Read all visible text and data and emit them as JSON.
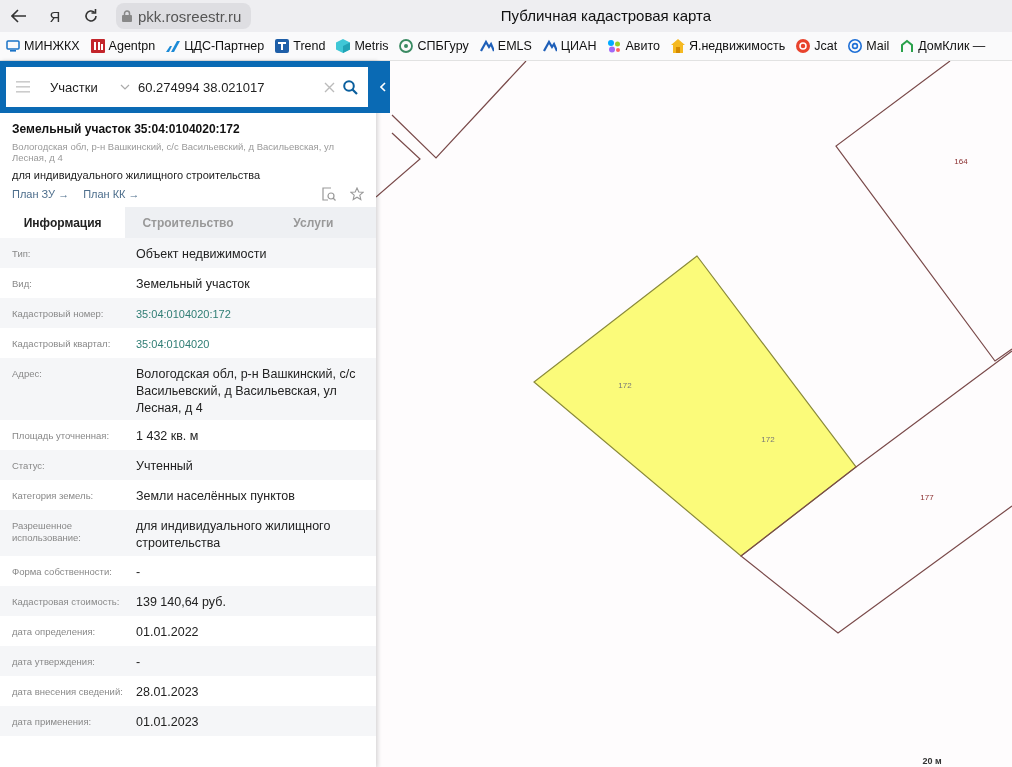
{
  "browser": {
    "home_glyph": "Я",
    "url": "pkk.rosreestr.ru",
    "page_title": "Публичная кадастровая карта"
  },
  "bookmarks": [
    {
      "label": "МИНЖКХ",
      "kind": "monitor"
    },
    {
      "label": "Agentpn",
      "kind": "agent"
    },
    {
      "label": "ЦДС-Партнер",
      "kind": "slash"
    },
    {
      "label": "Trend",
      "kind": "trend"
    },
    {
      "label": "Metris",
      "kind": "cube"
    },
    {
      "label": "СПБГуру",
      "kind": "pin"
    },
    {
      "label": "EMLS",
      "kind": "peak"
    },
    {
      "label": "ЦИАН",
      "kind": "peak"
    },
    {
      "label": "Авито",
      "kind": "dots"
    },
    {
      "label": "Я.недвижимость",
      "kind": "house"
    },
    {
      "label": "Jcat",
      "kind": "jcat"
    },
    {
      "label": "Mail",
      "kind": "at"
    },
    {
      "label": "ДомКлик —",
      "kind": "domklik"
    }
  ],
  "search": {
    "layer": "Участки",
    "query": "60.274994 38.021017"
  },
  "object": {
    "title": "Земельный участок 35:04:0104020:172",
    "address": "Вологодская обл, р-н Вашкинский, с/с Васильевский, д Васильевская, ул Лесная, д 4",
    "purpose": "для индивидуального жилищного строительства",
    "links": [
      "План ЗУ →",
      "План КК →"
    ]
  },
  "tabs": [
    {
      "label": "Информация",
      "selected": true
    },
    {
      "label": "Строительство",
      "selected": false
    },
    {
      "label": "Услуги",
      "selected": false
    }
  ],
  "fields": [
    {
      "label": "Тип:",
      "value": "Объект недвижимости",
      "kind": "text"
    },
    {
      "label": "Вид:",
      "value": "Земельный участок",
      "kind": "text"
    },
    {
      "label": "Кадастровый номер:",
      "value": "35:04:0104020:172",
      "kind": "link"
    },
    {
      "label": "Кадастровый квартал:",
      "value": "35:04:0104020",
      "kind": "link"
    },
    {
      "label": "Адрес:",
      "value": "Вологодская обл, р-н Вашкинский, с/с Васильевский, д Васильевская, ул Лесная, д 4",
      "kind": "text"
    },
    {
      "label": "Площадь уточненная:",
      "value": "1 432 кв. м",
      "kind": "text"
    },
    {
      "label": "Статус:",
      "value": "Учтенный",
      "kind": "text"
    },
    {
      "label": "Категория земель:",
      "value": "Земли населённых пунктов",
      "kind": "text"
    },
    {
      "label": "Разрешенное использование:",
      "value": "для индивидуального жилищного строительства",
      "kind": "text"
    },
    {
      "label": "Форма собственности:",
      "value": "-",
      "kind": "text"
    },
    {
      "label": "Кадастровая стоимость:",
      "value": "139 140,64 руб.",
      "kind": "text"
    },
    {
      "label": "дата определения:",
      "value": "01.01.2022",
      "kind": "text"
    },
    {
      "label": "дата утверждения:",
      "value": "-",
      "kind": "text"
    },
    {
      "label": "дата внесения сведений:",
      "value": "28.01.2023",
      "kind": "text"
    },
    {
      "label": "дата применения:",
      "value": "01.01.2023",
      "kind": "text"
    }
  ],
  "map": {
    "parcels": [
      {
        "labels": [
          "172",
          "172"
        ],
        "selected": true
      },
      {
        "labels": [
          "164"
        ],
        "selected": false
      },
      {
        "labels": [
          "177"
        ],
        "selected": false
      },
      {
        "selected": false
      },
      {
        "selected": false
      }
    ],
    "scale": "20 м"
  }
}
